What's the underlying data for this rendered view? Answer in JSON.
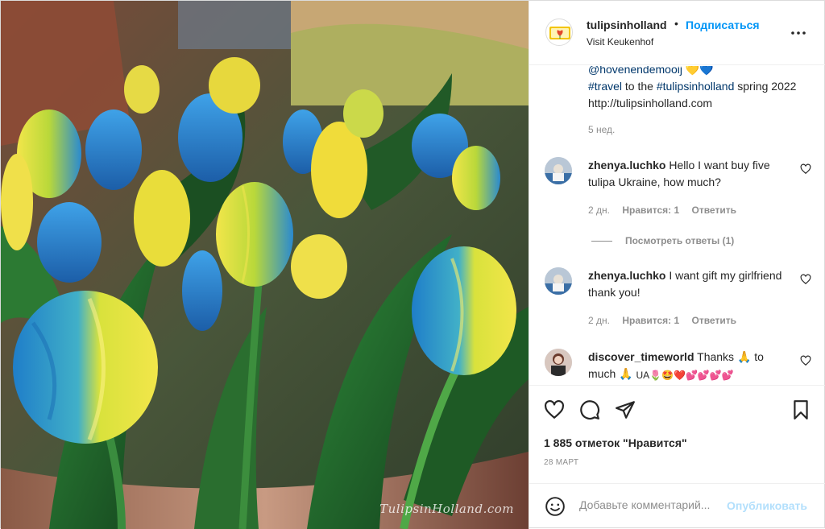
{
  "photo": {
    "alt_subject": "",
    "watermark": "TulipsinHolland.com"
  },
  "header": {
    "username": "tulipsinholland",
    "dot": "•",
    "follow_label": "Подписаться",
    "location": "Visit Keukenhof",
    "more_icon": "more-horizontal-icon"
  },
  "caption": {
    "mention": "@hovenendemooij",
    "hearts": "💛💙",
    "hashtag1": "#travel",
    "mid_text": " to the ",
    "hashtag2": "#tulipsinholland",
    "tail_text": " spring 2022 http://tulipsinholland.com",
    "time": "5 нед."
  },
  "comments": [
    {
      "username": "zhenya.luchko",
      "text": "Hello I want buy five tulipa Ukraine, how much?",
      "time": "2 дн.",
      "likes": "Нравится: 1",
      "reply": "Ответить"
    },
    {
      "username": "zhenya.luchko",
      "text": "I want gift my girlfriend thank you!",
      "time": "2 дн.",
      "likes": "Нравится: 1",
      "reply": "Ответить"
    },
    {
      "username": "discover_timeworld",
      "text": "Thanks 🙏 to much 🙏",
      "emoji_tail": "UA🌷🤩❤️💕💕💕💕",
      "time": "",
      "likes": "",
      "reply": ""
    }
  ],
  "view_replies": "Посмотреть ответы (1)",
  "actions": {
    "likes": "1 885 отметок \"Нравится\"",
    "date": "28 МАРТ"
  },
  "add_comment": {
    "placeholder": "Добавьте комментарий...",
    "publish": "Опубликовать"
  },
  "colors": {
    "link_blue": "#0095f6",
    "publish_disabled": "#b2dffc",
    "text_secondary": "#8e8e8e",
    "divider": "#efefef"
  }
}
